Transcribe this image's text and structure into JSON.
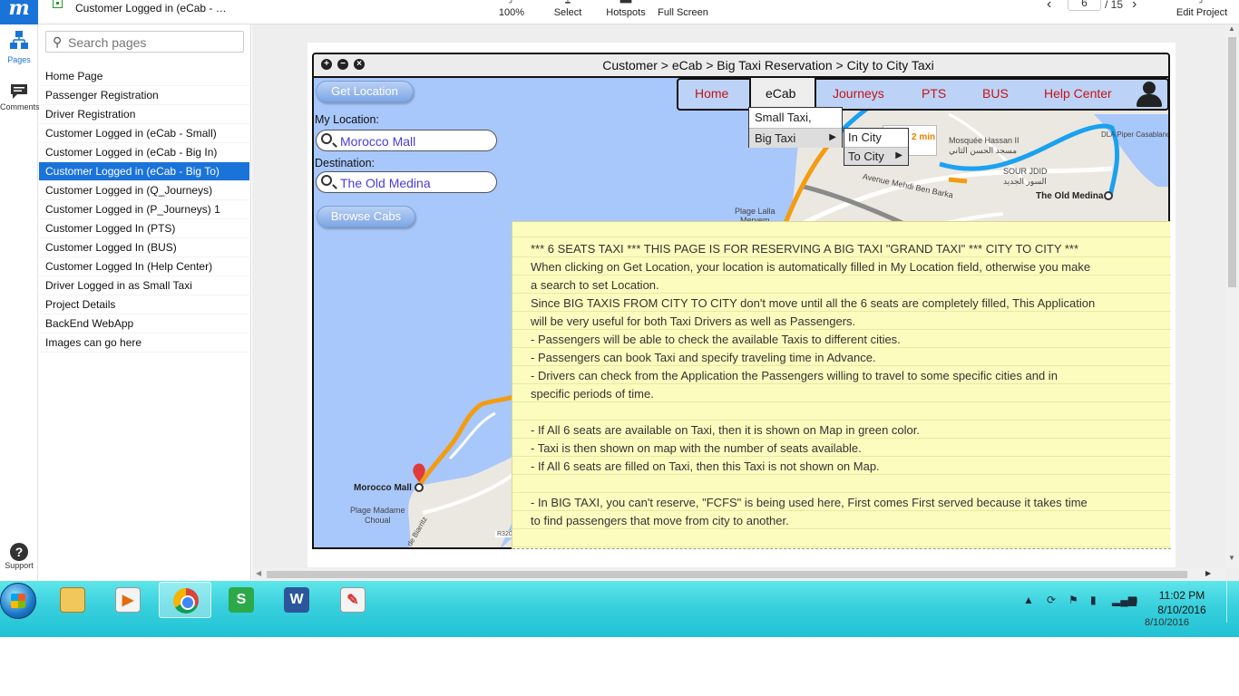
{
  "app": {
    "logo": "m",
    "doc_title": "Customer Logged in (eCab - …"
  },
  "toolbar": {
    "zoom_label": "100%",
    "select_label": "Select",
    "hotspots_label": "Hotspots",
    "fullscreen_label": "Full Screen",
    "page_number": "6",
    "page_total": "/ 15",
    "edit_label": "Edit Project"
  },
  "rail": {
    "pages_label": "Pages",
    "comments_label": "Comments",
    "support_label": "Support"
  },
  "sidebar": {
    "search_placeholder": "Search pages",
    "pages": [
      {
        "label": "Home Page"
      },
      {
        "label": "Passenger Registration"
      },
      {
        "label": "Driver Registration"
      },
      {
        "label": "Customer Logged in (eCab - Small)"
      },
      {
        "label": "Customer Logged in (eCab - Big In)"
      },
      {
        "label": "Customer Logged in (eCab - Big To)"
      },
      {
        "label": "Customer Logged in (Q_Journeys)"
      },
      {
        "label": "Customer Logged in (P_Journeys) 1"
      },
      {
        "label": "Customer Logged In (PTS)"
      },
      {
        "label": "Customer Logged In (BUS)"
      },
      {
        "label": "Customer Logged In (Help Center)"
      },
      {
        "label": "Driver Logged in as Small Taxi"
      },
      {
        "label": "Project Details"
      },
      {
        "label": "BackEnd WebApp"
      },
      {
        "label": "Images can go here"
      }
    ],
    "active_index": 5
  },
  "mockup": {
    "window_buttons": [
      "+",
      "−",
      "×"
    ],
    "title": "Customer > eCab > Big Taxi Reservation > City to City Taxi",
    "get_location": "Get Location",
    "my_location_label": "My Location:",
    "my_location_value": "Morocco Mall",
    "destination_label": "Destination:",
    "destination_value": "The Old Medina",
    "browse_cabs": "Browse Cabs",
    "nav": {
      "home": "Home",
      "ecab": "eCab",
      "journeys": "Journeys",
      "pts": "PTS",
      "bus": "BUS",
      "help": "Help Center"
    },
    "dropdown": {
      "small_taxi": "Small Taxi,",
      "big_taxi": "Big Taxi",
      "in_city": "In City",
      "to_city": "To City"
    },
    "map": {
      "labels": {
        "mall": "Morocco Mall",
        "medina": "The Old Medina",
        "plage_madame": "Plage Madame",
        "choual": "Choual",
        "plage_lalla": "Plage Lalla",
        "meryem": "Meryem",
        "mosquee": "Mosquée Hassan II",
        "mosquee_ar": "مسجد الحسن الثاني",
        "avenue": "Avenue Mehdi Ben Barka",
        "sour_jdid": "SOUR JDID",
        "sour_jdid_ar": "السور الجديد",
        "dla": "DLA Piper Casablanca",
        "r320": "R320",
        "biarritz": "de Biarritz",
        "traffic": "2 min"
      },
      "route_color": "#1aa1f0",
      "traffic_color": "#f39c12"
    },
    "note": {
      "lines": [
        "*** 6 SEATS TAXI *** THIS PAGE IS FOR RESERVING A BIG TAXI \"GRAND TAXI\" *** CITY TO CITY ***",
        "When clicking on Get Location, your location is automatically filled in My Location field, otherwise you make",
        "a search to set Location.",
        "Since BIG TAXIS FROM CITY TO CITY don't move until all the 6 seats are completely filled, This Application",
        "will be very useful for both Taxi Drivers as well as Passengers.",
        "- Passengers will be able to check the available Taxis to different cities.",
        "- Passengers can book Taxi and specify traveling time in Advance.",
        "- Drivers can check from the Application the Passengers willing to travel to some specific cities and in",
        "specific periods of time.",
        "",
        "- If All 6 seats are available on Taxi, then it is shown on Map in green color.",
        "- Taxi is then shown on map with the number of seats available.",
        "- If All 6 seats are filled on Taxi, then this Taxi is not shown on Map.",
        "",
        "- In BIG TAXI, you can't reserve, \"FCFS\" is being used here, First comes First served because it takes time",
        "to find passengers that move from city to another."
      ]
    }
  },
  "taskbar": {
    "apps": [
      "explorer",
      "media-player",
      "chrome",
      "slides",
      "word",
      "paint"
    ],
    "active_app": "chrome",
    "time": "11:02 PM",
    "date": "8/10/2016",
    "ghost_date": "8/10/2016"
  }
}
